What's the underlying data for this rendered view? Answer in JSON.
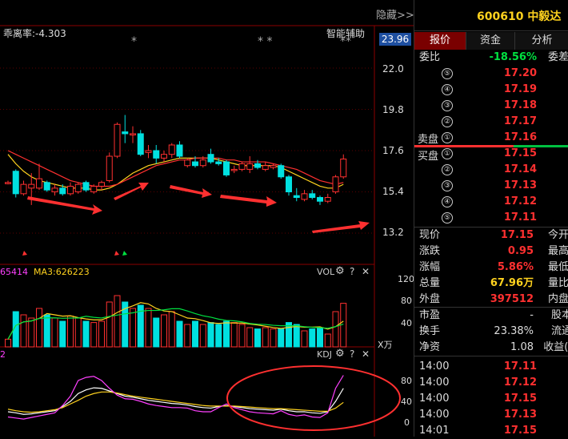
{
  "chart": {
    "bias_label": "乖离率:-4.303",
    "assist_label": "智能辅助",
    "hide_label": "隐藏>>",
    "price_badge": "23.96",
    "y_ticks": [
      "22.0",
      "19.8",
      "17.6",
      "15.4",
      "13.2"
    ],
    "asterisks": [
      "*",
      "* *",
      "**"
    ],
    "vol_header_value": "65414",
    "vol_ma3": "MA3:626223",
    "vol_label": "VOL",
    "vol_ticks": [
      "120",
      "80",
      "40"
    ],
    "vol_unit": "X万",
    "kdj_label": "KDJ",
    "kdj_ticks": [
      "80",
      "40",
      "0"
    ],
    "kdj_header_value": "2",
    "question_icon": "?",
    "close_icon": "✕",
    "candles": [
      {
        "o": 15.9,
        "c": 15.9,
        "h": 16.0,
        "l": 15.8
      },
      {
        "o": 16.5,
        "c": 15.3,
        "h": 16.6,
        "l": 15.1
      },
      {
        "o": 15.3,
        "c": 15.8,
        "h": 16.0,
        "l": 15.2
      },
      {
        "o": 15.6,
        "c": 15.8,
        "h": 16.4,
        "l": 14.7
      },
      {
        "o": 15.6,
        "c": 16.1,
        "h": 16.9,
        "l": 15.5
      },
      {
        "o": 15.9,
        "c": 15.5,
        "h": 16.0,
        "l": 15.4
      },
      {
        "o": 15.4,
        "c": 15.6,
        "h": 15.8,
        "l": 15.2
      },
      {
        "o": 15.6,
        "c": 15.3,
        "h": 15.8,
        "l": 15.2
      },
      {
        "o": 15.3,
        "c": 15.7,
        "h": 15.9,
        "l": 15.2
      },
      {
        "o": 15.4,
        "c": 15.8,
        "h": 15.9,
        "l": 15.3
      },
      {
        "o": 15.9,
        "c": 15.5,
        "h": 16.0,
        "l": 15.4
      },
      {
        "o": 15.4,
        "c": 15.7,
        "h": 15.8,
        "l": 15.3
      },
      {
        "o": 15.7,
        "c": 15.9,
        "h": 16.0,
        "l": 15.5
      },
      {
        "o": 16.0,
        "c": 17.3,
        "h": 17.5,
        "l": 15.9
      },
      {
        "o": 17.3,
        "c": 19.0,
        "h": 19.1,
        "l": 17.2
      },
      {
        "o": 18.6,
        "c": 18.5,
        "h": 19.5,
        "l": 18.0
      },
      {
        "o": 18.5,
        "c": 18.5,
        "h": 18.9,
        "l": 18.0
      },
      {
        "o": 18.5,
        "c": 17.4,
        "h": 18.7,
        "l": 17.3
      },
      {
        "o": 17.5,
        "c": 17.6,
        "h": 17.9,
        "l": 17.2
      },
      {
        "o": 17.6,
        "c": 17.2,
        "h": 17.9,
        "l": 16.9
      },
      {
        "o": 17.2,
        "c": 17.4,
        "h": 17.6,
        "l": 17.0
      },
      {
        "o": 17.4,
        "c": 17.9,
        "h": 18.0,
        "l": 17.2
      },
      {
        "o": 17.9,
        "c": 17.3,
        "h": 18.1,
        "l": 17.2
      },
      {
        "o": 16.8,
        "c": 17.1,
        "h": 17.2,
        "l": 16.7
      },
      {
        "o": 17.0,
        "c": 16.8,
        "h": 17.3,
        "l": 16.7
      },
      {
        "o": 16.8,
        "c": 17.1,
        "h": 17.3,
        "l": 16.7
      },
      {
        "o": 17.4,
        "c": 17.0,
        "h": 17.7,
        "l": 16.9
      },
      {
        "o": 17.0,
        "c": 16.9,
        "h": 17.2,
        "l": 16.8
      },
      {
        "o": 17.0,
        "c": 16.3,
        "h": 17.1,
        "l": 16.2
      },
      {
        "o": 16.6,
        "c": 16.6,
        "h": 16.8,
        "l": 16.4
      },
      {
        "o": 16.6,
        "c": 16.9,
        "h": 17.0,
        "l": 16.5
      },
      {
        "o": 16.6,
        "c": 16.9,
        "h": 17.3,
        "l": 16.4
      },
      {
        "o": 16.9,
        "c": 16.7,
        "h": 17.1,
        "l": 16.6
      },
      {
        "o": 16.6,
        "c": 16.8,
        "h": 17.0,
        "l": 16.5
      },
      {
        "o": 16.7,
        "c": 16.8,
        "h": 16.9,
        "l": 16.6
      },
      {
        "o": 16.8,
        "c": 16.2,
        "h": 16.9,
        "l": 16.1
      },
      {
        "o": 16.2,
        "c": 15.4,
        "h": 16.3,
        "l": 15.2
      },
      {
        "o": 15.2,
        "c": 15.1,
        "h": 15.6,
        "l": 14.9
      },
      {
        "o": 15.0,
        "c": 15.3,
        "h": 15.5,
        "l": 14.9
      },
      {
        "o": 15.3,
        "c": 15.1,
        "h": 15.5,
        "l": 15.0
      },
      {
        "o": 15.1,
        "c": 14.9,
        "h": 15.2,
        "l": 14.7
      },
      {
        "o": 14.9,
        "c": 15.1,
        "h": 15.3,
        "l": 14.8
      },
      {
        "o": 15.4,
        "c": 16.2,
        "h": 16.3,
        "l": 15.3
      },
      {
        "o": 16.2,
        "c": 17.15,
        "h": 17.4,
        "l": 16.1
      }
    ],
    "volumes": [
      12,
      55,
      50,
      45,
      60,
      50,
      45,
      40,
      48,
      45,
      40,
      38,
      40,
      70,
      80,
      70,
      60,
      65,
      60,
      45,
      50,
      55,
      40,
      35,
      40,
      35,
      38,
      35,
      40,
      38,
      35,
      30,
      28,
      30,
      28,
      28,
      38,
      35,
      25,
      28,
      30,
      20,
      55,
      68
    ],
    "ma_yellow": [
      17.4,
      16.9,
      16.5,
      16.2,
      16.0,
      15.9,
      15.8,
      15.7,
      15.6,
      15.6,
      15.6,
      15.5,
      15.5,
      15.6,
      15.8,
      16.1,
      16.4,
      16.6,
      16.8,
      16.9,
      17.0,
      17.1,
      17.2,
      17.2,
      17.2,
      17.2,
      17.2,
      17.1,
      17.0,
      16.9,
      16.8,
      16.8,
      16.8,
      16.8,
      16.8,
      16.7,
      16.5,
      16.3,
      16.1,
      15.9,
      15.7,
      15.6,
      15.6,
      15.8
    ],
    "ma_red": [
      17.6,
      17.4,
      17.2,
      17.0,
      16.8,
      16.6,
      16.4,
      16.2,
      16.0,
      15.9,
      15.8,
      15.7,
      15.7,
      15.7,
      15.8,
      16.0,
      16.2,
      16.4,
      16.6,
      16.8,
      16.9,
      17.0,
      17.1,
      17.1,
      17.2,
      17.2,
      17.2,
      17.2,
      17.1,
      17.1,
      17.0,
      17.0,
      17.0,
      17.0,
      16.9,
      16.8,
      16.7,
      16.6,
      16.4,
      16.2,
      16.0,
      15.9,
      15.8,
      15.9
    ],
    "kdj_k": [
      20,
      18,
      15,
      16,
      18,
      20,
      22,
      30,
      40,
      55,
      62,
      66,
      65,
      60,
      55,
      50,
      48,
      45,
      42,
      40,
      38,
      36,
      35,
      33,
      30,
      28,
      27,
      30,
      32,
      30,
      28,
      26,
      25,
      24,
      23,
      25,
      22,
      20,
      20,
      18,
      17,
      20,
      40,
      65
    ],
    "kdj_d": [
      25,
      22,
      20,
      19,
      20,
      22,
      24,
      28,
      35,
      42,
      50,
      55,
      58,
      58,
      56,
      53,
      50,
      48,
      46,
      44,
      42,
      40,
      38,
      36,
      34,
      32,
      31,
      31,
      31,
      31,
      30,
      29,
      28,
      27,
      26,
      26,
      25,
      24,
      23,
      22,
      21,
      21,
      27,
      38
    ],
    "kdj_j": [
      10,
      8,
      6,
      9,
      12,
      15,
      18,
      32,
      50,
      80,
      86,
      88,
      80,
      65,
      52,
      45,
      44,
      40,
      35,
      32,
      30,
      28,
      28,
      27,
      22,
      20,
      20,
      28,
      35,
      28,
      24,
      20,
      18,
      17,
      16,
      22,
      15,
      12,
      14,
      10,
      9,
      18,
      65,
      90
    ]
  },
  "quote": {
    "code_name": "600610 中毅达",
    "tabs": [
      "报价",
      "资金",
      "分析"
    ],
    "weibi_label": "委比",
    "weibi_value": "-18.56%",
    "weicha_label": "委差",
    "sell_label": "卖盘",
    "buy_label": "买盘",
    "sell": [
      {
        "n": "⑤",
        "p": "17.20"
      },
      {
        "n": "④",
        "p": "17.19"
      },
      {
        "n": "③",
        "p": "17.18"
      },
      {
        "n": "②",
        "p": "17.17"
      },
      {
        "n": "①",
        "p": "17.16"
      }
    ],
    "buy": [
      {
        "n": "①",
        "p": "17.15"
      },
      {
        "n": "②",
        "p": "17.14"
      },
      {
        "n": "③",
        "p": "17.13"
      },
      {
        "n": "④",
        "p": "17.12"
      },
      {
        "n": "⑤",
        "p": "17.11"
      }
    ],
    "stats": [
      {
        "l": "现价",
        "v": "17.15",
        "r": "今开",
        "c": "red"
      },
      {
        "l": "涨跌",
        "v": "0.95",
        "r": "最高",
        "c": "red"
      },
      {
        "l": "涨幅",
        "v": "5.86%",
        "r": "最低",
        "c": "red"
      },
      {
        "l": "总量",
        "v": "67.96万",
        "r": "量比",
        "c": "yellow"
      },
      {
        "l": "外盘",
        "v": "397512",
        "r": "内盘",
        "c": "red"
      }
    ],
    "fund": [
      {
        "l": "市盈",
        "v": "-",
        "r": "股本"
      },
      {
        "l": "换手",
        "v": "23.38%",
        "r": "流通"
      },
      {
        "l": "净资",
        "v": "1.08",
        "r": "收益(-"
      }
    ],
    "ticks": [
      {
        "t": "14:00",
        "p": "17.11"
      },
      {
        "t": "14:00",
        "p": "17.12"
      },
      {
        "t": "14:00",
        "p": "17.15"
      },
      {
        "t": "14:00",
        "p": "17.13"
      },
      {
        "t": "14:01",
        "p": "17.15"
      }
    ]
  }
}
